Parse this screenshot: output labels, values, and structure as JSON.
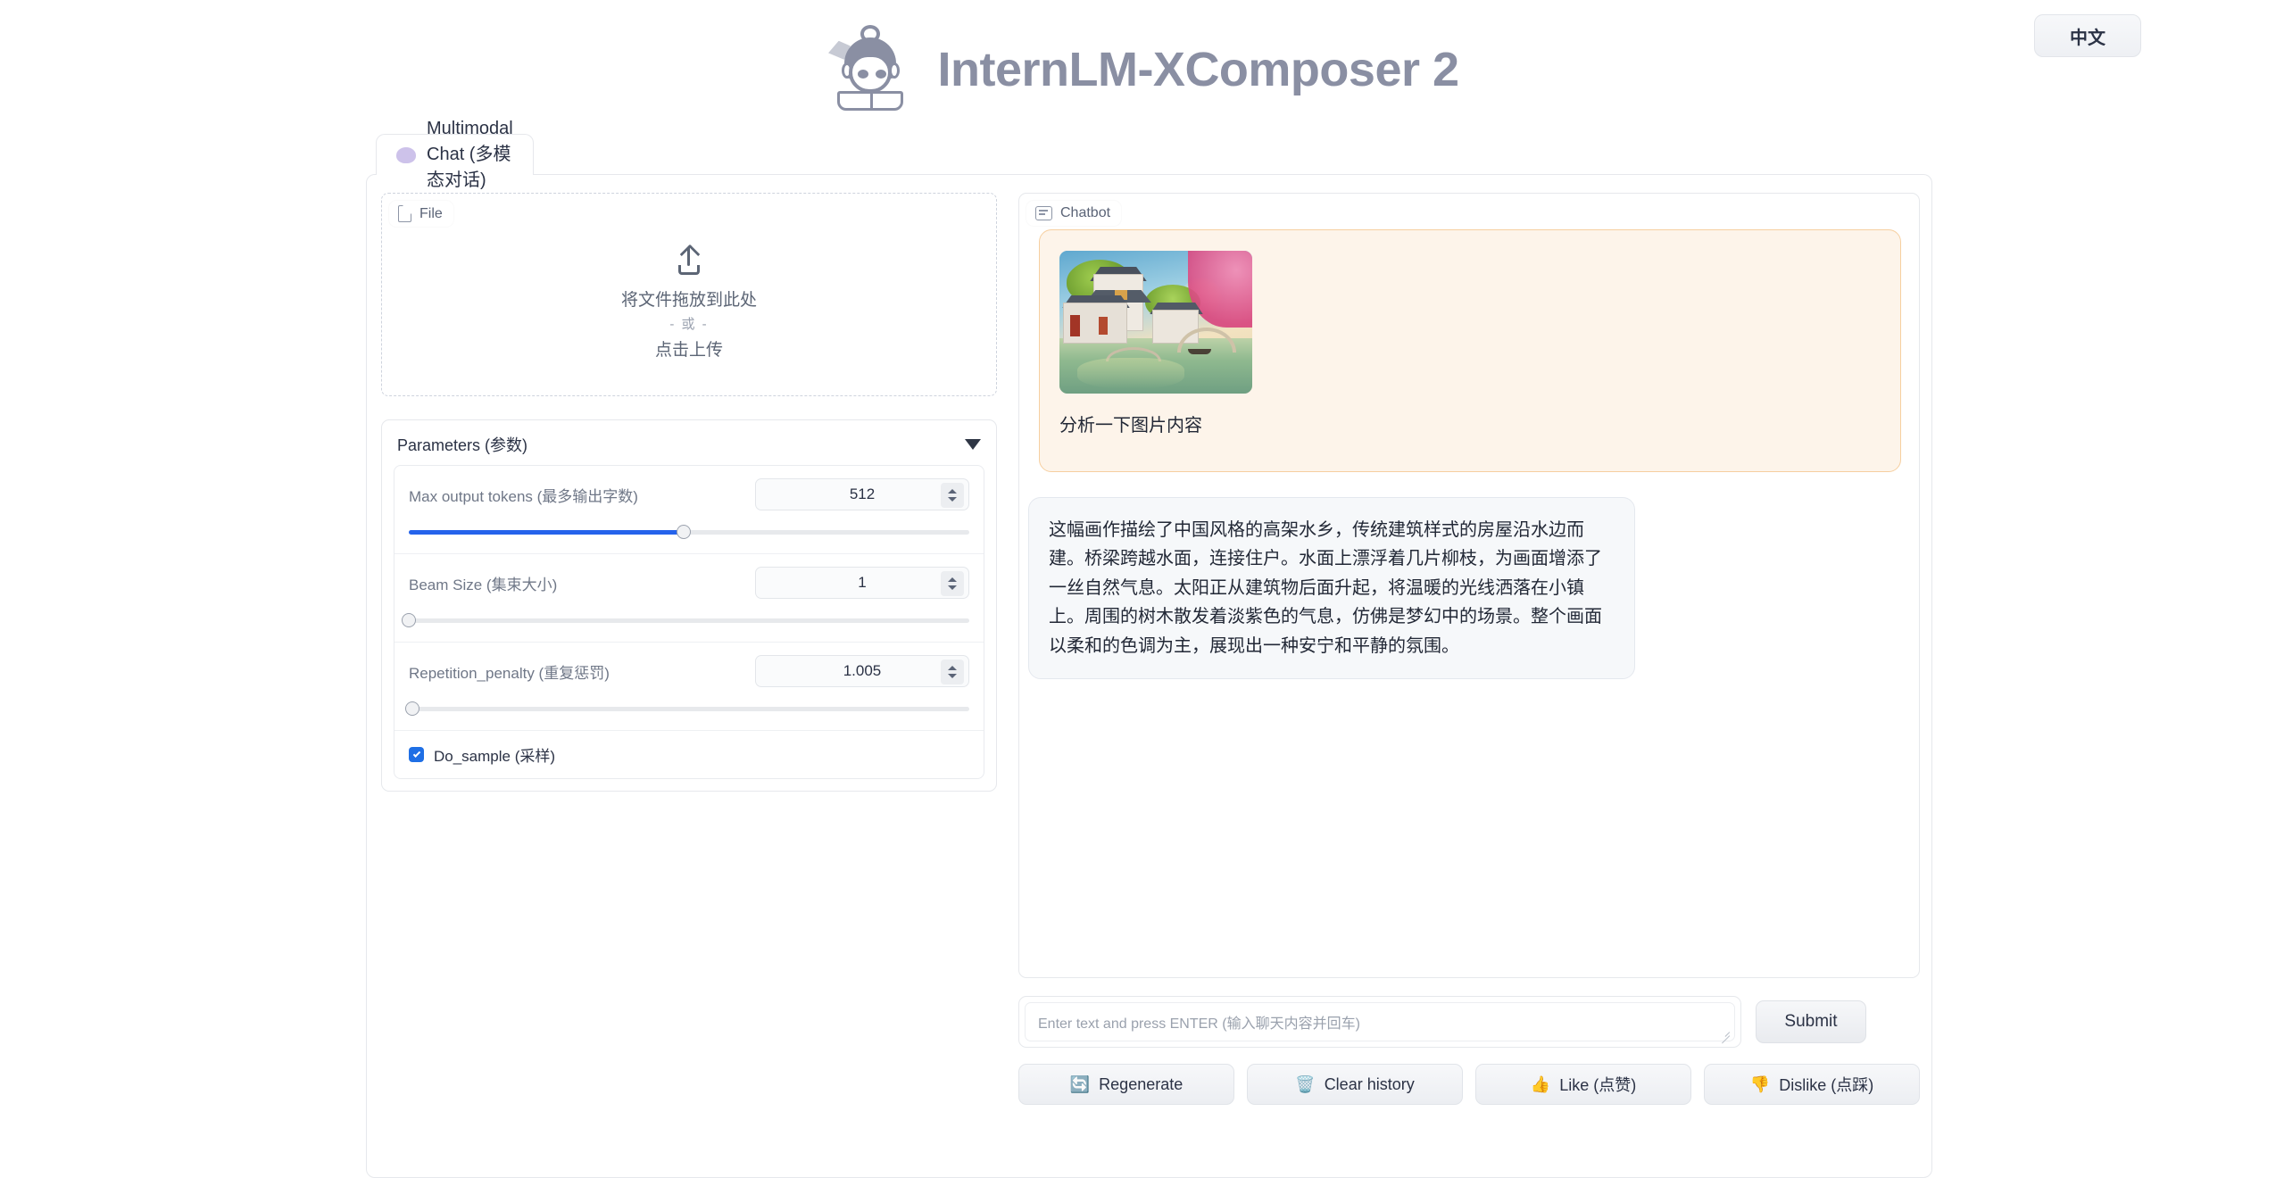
{
  "header": {
    "title": "InternLM-XComposer 2",
    "logo_icon": "internlm-character-logo",
    "language_button": "中文"
  },
  "tabs": [
    {
      "label": "Multimodal Chat (多模态对话)",
      "icon": "speech-bubble-icon",
      "active": true
    }
  ],
  "upload": {
    "panel_label": "File",
    "panel_icon": "file-icon",
    "upload_icon": "upload-arrow-icon",
    "drop_text": "将文件拖放到此处",
    "or_text": "- 或 -",
    "click_text": "点击上传"
  },
  "parameters": {
    "title": "Parameters (参数)",
    "collapse_icon": "caret-down-icon",
    "rows": [
      {
        "label": "Max output tokens (最多输出字数)",
        "value": "512",
        "fill_percent": 49
      },
      {
        "label": "Beam Size (集束大小)",
        "value": "1",
        "fill_percent": 0
      },
      {
        "label": "Repetition_penalty (重复惩罚)",
        "value": "1.005",
        "fill_percent": 0
      }
    ],
    "checkbox": {
      "label": "Do_sample (采样)",
      "checked": true
    }
  },
  "chatbot": {
    "panel_label": "Chatbot",
    "panel_icon": "chat-icon",
    "user_message": {
      "image_alt": "chinese-water-town-painting",
      "text": "分析一下图片内容"
    },
    "bot_message": {
      "text": "这幅画作描绘了中国风格的高架水乡，传统建筑样式的房屋沿水边而建。桥梁跨越水面，连接住户。水面上漂浮着几片柳枝，为画面增添了一丝自然气息。太阳正从建筑物后面升起，将温暖的光线洒落在小镇上。周围的树木散发着淡紫色的气息，仿佛是梦幻中的场景。整个画面以柔和的色调为主，展现出一种安宁和平静的氛围。"
    }
  },
  "input": {
    "placeholder": "Enter text and press ENTER (输入聊天内容并回车)",
    "value": "",
    "submit_label": "Submit",
    "resize_icon": "resize-grip-icon"
  },
  "actions": [
    {
      "label": "Regenerate",
      "icon": "🔄"
    },
    {
      "label": "Clear history",
      "icon": "🗑️"
    },
    {
      "label": "Like (点赞)",
      "icon": "👍"
    },
    {
      "label": "Dislike (点踩)",
      "icon": "👎"
    }
  ],
  "colors": {
    "brand_gray": "#8a8fa3",
    "slider_blue": "#2563eb",
    "checkbox_blue": "#1f6fe5",
    "user_bubble_bg": "#fdf4ea",
    "user_bubble_border": "#f6cfa0",
    "bot_bubble_bg": "#f6f8fa"
  }
}
